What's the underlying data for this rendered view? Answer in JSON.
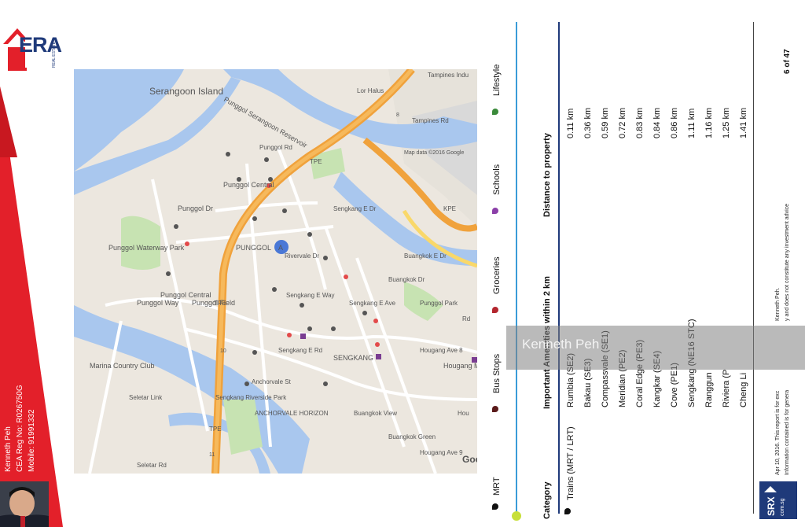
{
  "agent": {
    "name": "Kenneth Peh",
    "cea_reg": "CEA Reg No: R026750G",
    "mobile": "Mobile: 91991332"
  },
  "brand": {
    "logo_text": "ERA",
    "logo_sub": "REAL ESTATE",
    "accent": "#e3202a",
    "navy": "#1f3a7a"
  },
  "map": {
    "labels": {
      "serangoon_island": "Serangoon Island",
      "reservoir": "Punggol Serangoon Reservoir",
      "lor_halus": "Lor Halus",
      "tampines_industrial": "Tampines Indu",
      "tampines_rd": "Tampines Rd",
      "map_data": "Map data ©2016 Google",
      "punggol_waterway_park": "Punggol Waterway Park",
      "punggol_dr": "Punggol Dr",
      "punggol_central_1": "Punggol Central",
      "punggol_central_2": "Punggol Central",
      "punggol_rd": "Punggol Rd",
      "punggol": "PUNGGOL",
      "punggol_way": "Punggol Way",
      "punggol_field": "Punggol Field",
      "tpe_1": "TPE",
      "tpe_2": "TPE",
      "tpe_3": "TPE",
      "kpe": "KPE",
      "sengkang_e_dr": "Sengkang E Dr",
      "buangkok_e_dr": "Buangkok E Dr",
      "buangkok_dr": "Buangkok Dr",
      "punggol_park": "Punggol Park",
      "rivervale_dr": "Rivervale Dr",
      "sengkang_e_way": "Sengkang E Way",
      "sengkang_e_ave": "Sengkang E Ave",
      "sengkang_e_rd": "Sengkang E Rd",
      "sengkang": "SENGKANG",
      "hougang_ave8": "Hougang Ave 8",
      "hougang_mall": "Hougang Mall",
      "marina_country_club": "Marina Country Club",
      "seletar_link": "Seletar Link",
      "sengkang_riverside_park": "Sengkang Riverside Park",
      "anchorvale_st": "Anchorvale St",
      "anchorvale_horizon": "ANCHORVALE HORIZON",
      "buangkok_view": "Buangkok View",
      "buangkok_green": "Buangkok Green",
      "hougang_ave9": "Hougang Ave 9",
      "seletar_rd": "Seletar Rd",
      "pin_a": "A",
      "google": "Google",
      "hou": "Hou",
      "rd": "Rd",
      "exit_10": "10",
      "exit_11": "11",
      "exit_8": "8"
    }
  },
  "legend": [
    {
      "label": "MRT",
      "color": "#111111"
    },
    {
      "label": "Bus Stops",
      "color": "#5a1a1a"
    },
    {
      "label": "Groceries",
      "color": "#b3262e"
    },
    {
      "label": "Schools",
      "color": "#8b3fa8"
    },
    {
      "label": "Lifestyle",
      "color": "#3a8a3a"
    }
  ],
  "table": {
    "headers": {
      "category": "Category",
      "amenities": "Important Amenities within 2 km",
      "distance": "Distance to property"
    },
    "category": "Trains (MRT / LRT)",
    "rows": [
      {
        "name": "Rumbia (SE2)",
        "distance": "0.11 km"
      },
      {
        "name": "Bakau (SE3)",
        "distance": "0.36 km"
      },
      {
        "name": "Compassvale (SE1)",
        "distance": "0.59 km"
      },
      {
        "name": "Meridian (PE2)",
        "distance": "0.72 km"
      },
      {
        "name": "Coral Edge (PE3)",
        "distance": "0.83 km"
      },
      {
        "name": "Kangkar (SE4)",
        "distance": "0.84 km"
      },
      {
        "name": "Cove (PE1)",
        "distance": "0.86 km"
      },
      {
        "name": "Sengkang (NE16 STC)",
        "distance": "1.11 km"
      },
      {
        "name": "Ranggun",
        "distance": "1.16 km"
      },
      {
        "name": "Riviera (P",
        "distance": "1.25 km"
      },
      {
        "name": "Cheng Li",
        "distance": "1.41 km"
      }
    ]
  },
  "footer": {
    "page": "6 of 47",
    "disclaimer_1": "Apr 10, 2016. This report is for exc",
    "disclaimer_1b": "Kenneth Peh.",
    "disclaimer_2": "Information contained is for genera",
    "disclaimer_2b": "y and does not constitute any investment advice",
    "srx_text": "SRX",
    "srx_sub": "com.sg"
  },
  "watermark": "Kenneth Peh"
}
